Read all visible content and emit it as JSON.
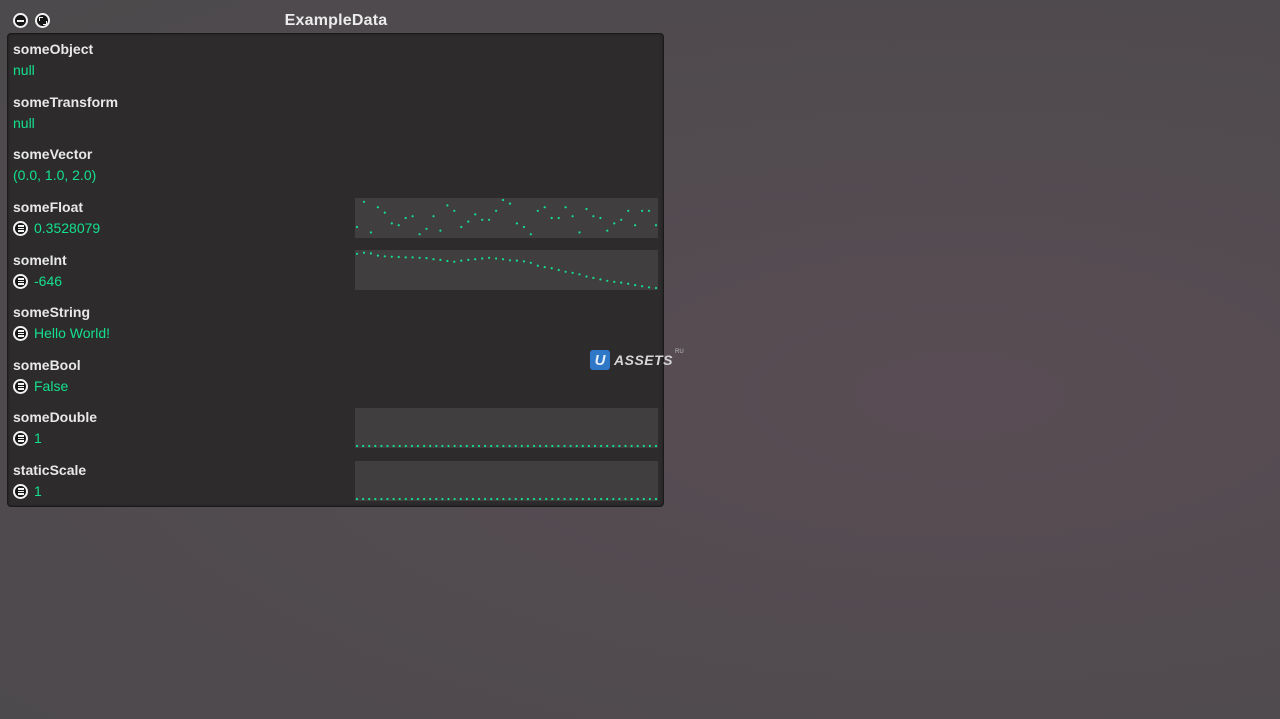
{
  "window": {
    "title": "ExampleData"
  },
  "fields": [
    {
      "label": "someObject",
      "value": "null",
      "has_menu": false
    },
    {
      "label": "someTransform",
      "value": "null",
      "has_menu": false
    },
    {
      "label": "someVector",
      "value": "(0.0, 1.0, 2.0)",
      "has_menu": false
    },
    {
      "label": "someFloat",
      "value": "0.3528079",
      "has_menu": true
    },
    {
      "label": "someInt",
      "value": "-646",
      "has_menu": true
    },
    {
      "label": "someString",
      "value": "Hello World!",
      "has_menu": true
    },
    {
      "label": "someBool",
      "value": "False",
      "has_menu": true
    },
    {
      "label": "someDouble",
      "value": "1",
      "has_menu": true
    },
    {
      "label": "staticScale",
      "value": "1",
      "has_menu": true
    }
  ],
  "graphs": {
    "someFloat": [
      0.25,
      0.95,
      0.1,
      0.8,
      0.65,
      0.35,
      0.3,
      0.5,
      0.55,
      0.05,
      0.2,
      0.55,
      0.15,
      0.85,
      0.7,
      0.25,
      0.4,
      0.6,
      0.45,
      0.45,
      0.7,
      1.0,
      0.9,
      0.35,
      0.25,
      0.05,
      0.7,
      0.8,
      0.5,
      0.5,
      0.8,
      0.55,
      0.1,
      0.75,
      0.55,
      0.5,
      0.15,
      0.35,
      0.45,
      0.7,
      0.3,
      0.7,
      0.7,
      0.3
    ],
    "someInt": [
      0.95,
      0.98,
      0.96,
      0.9,
      0.88,
      0.87,
      0.86,
      0.85,
      0.85,
      0.84,
      0.83,
      0.8,
      0.78,
      0.75,
      0.73,
      0.76,
      0.78,
      0.8,
      0.82,
      0.84,
      0.82,
      0.8,
      0.77,
      0.76,
      0.74,
      0.7,
      0.62,
      0.58,
      0.55,
      0.5,
      0.45,
      0.42,
      0.38,
      0.32,
      0.28,
      0.24,
      0.2,
      0.17,
      0.15,
      0.12,
      0.08,
      0.05,
      0.02,
      0.0
    ],
    "someDouble": [
      0.0
    ],
    "staticScale": [
      0.0
    ]
  },
  "watermark": {
    "badge": "U",
    "text": "ASSETS",
    "sup": "RU"
  },
  "colors": {
    "accent": "#14e08e",
    "panel": "#2d2b2c",
    "graph_bg": "#403e3f"
  },
  "icons": {
    "minimize": "minimize-icon",
    "maximize": "maximize-icon",
    "menu": "menu-icon"
  }
}
